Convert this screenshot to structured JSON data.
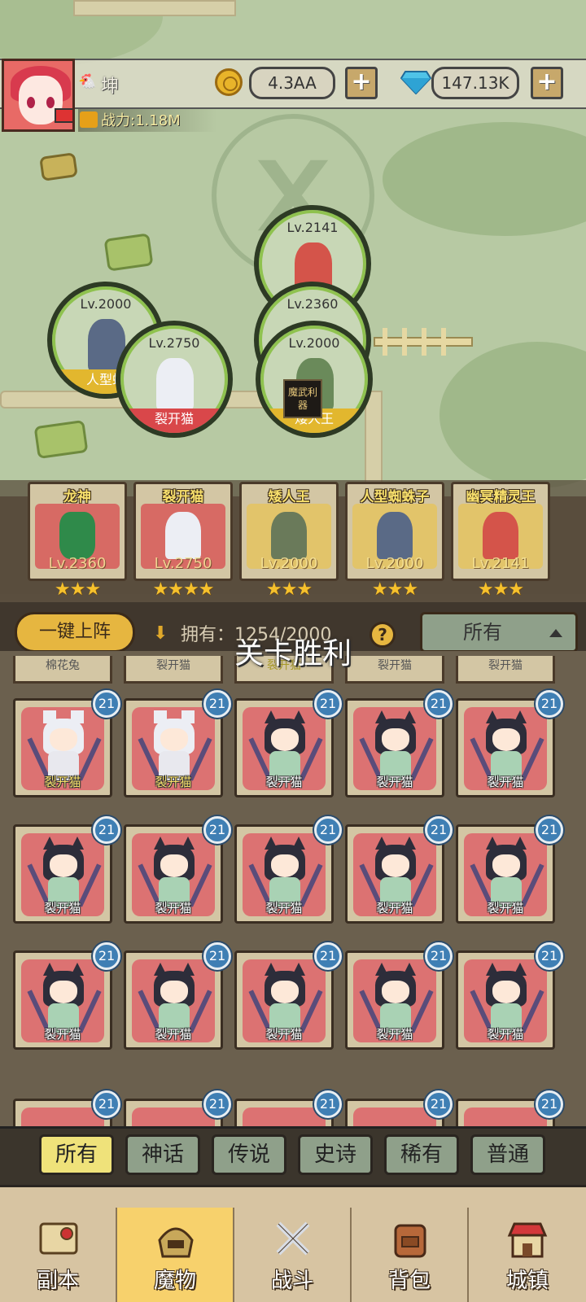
{
  "player": {
    "name": "坤",
    "power_label": "战力:1.18M"
  },
  "currency": {
    "gold": "4.3AA",
    "diamonds": "147.13K",
    "plus": "+"
  },
  "map": {
    "monsters": [
      {
        "level": "Lv.2141",
        "label": ""
      },
      {
        "level": "Lv.2000",
        "label": "人型蜘"
      },
      {
        "level": "Lv.2360",
        "label": ""
      },
      {
        "level": "Lv.2750",
        "label": "裂开猫"
      },
      {
        "level": "Lv.2000",
        "label": "矮人王"
      }
    ],
    "seal_text": "魔武利器"
  },
  "team": [
    {
      "name": "龙神",
      "level": "Lv.2360",
      "stars": "★★★"
    },
    {
      "name": "裂开猫",
      "level": "Lv.2750",
      "stars": "★★★★"
    },
    {
      "name": "矮人王",
      "level": "Lv.2000",
      "stars": "★★★"
    },
    {
      "name": "人型蜘蛛子",
      "level": "Lv.2000",
      "stars": "★★★"
    },
    {
      "name": "幽冥精灵王",
      "level": "Lv.2141",
      "stars": "★★★"
    }
  ],
  "controls": {
    "one_key_deploy": "一键上阵",
    "owned": "拥有：1254/2000",
    "help": "?",
    "filter_selected": "所有"
  },
  "toast": "关卡胜利",
  "partial_row": [
    "棉花兔",
    "裂开猫",
    "裂开猫",
    "裂开猫",
    "裂开猫"
  ],
  "grid": {
    "cards": [
      {
        "name": "裂开猫",
        "badge": "21"
      },
      {
        "name": "裂开猫",
        "badge": "21"
      },
      {
        "name": "裂开猫",
        "badge": "21"
      },
      {
        "name": "裂开猫",
        "badge": "21"
      },
      {
        "name": "裂开猫",
        "badge": "21"
      },
      {
        "name": "裂开猫",
        "badge": "21"
      },
      {
        "name": "裂开猫",
        "badge": "21"
      },
      {
        "name": "裂开猫",
        "badge": "21"
      },
      {
        "name": "裂开猫",
        "badge": "21"
      },
      {
        "name": "裂开猫",
        "badge": "21"
      },
      {
        "name": "裂开猫",
        "badge": "21"
      },
      {
        "name": "裂开猫",
        "badge": "21"
      },
      {
        "name": "裂开猫",
        "badge": "21"
      },
      {
        "name": "裂开猫",
        "badge": "21"
      },
      {
        "name": "裂开猫",
        "badge": "21"
      }
    ],
    "bottom_badges": [
      "21",
      "21",
      "21",
      "21",
      "21"
    ]
  },
  "filter_tabs": [
    "所有",
    "神话",
    "传说",
    "史诗",
    "稀有",
    "普通"
  ],
  "nav": [
    "副本",
    "魔物",
    "战斗",
    "背包",
    "城镇"
  ]
}
